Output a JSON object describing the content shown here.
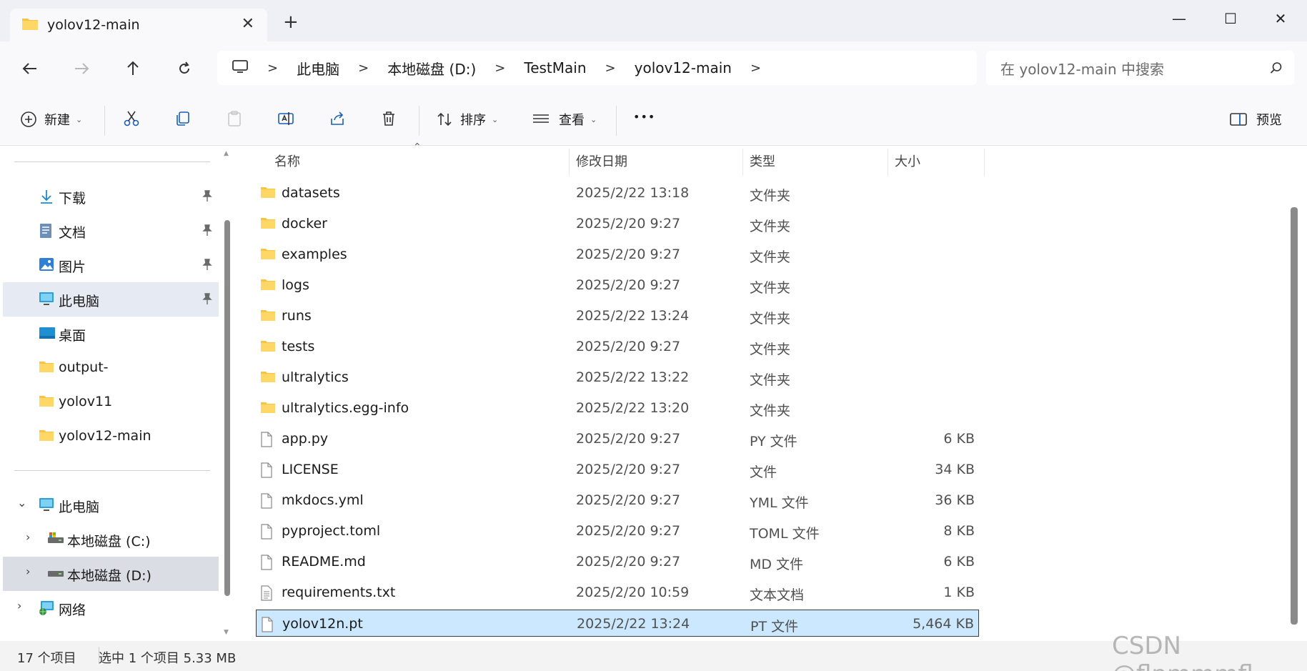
{
  "window": {
    "tab_title": "yolov12-main",
    "tab_close": "✕",
    "new_tab": "+",
    "minimize": "—",
    "maximize": "☐",
    "close": "✕"
  },
  "nav": {
    "breadcrumbs": [
      "此电脑",
      "本地磁盘 (D:)",
      "TestMain",
      "yolov12-main"
    ],
    "separator": ">",
    "search_placeholder": "在 yolov12-main 中搜索"
  },
  "toolbar": {
    "new_label": "新建",
    "sort_label": "排序",
    "view_label": "查看",
    "more_label": "•••",
    "preview_label": "预览"
  },
  "sidebar": {
    "quick_access": [
      {
        "label": "下载",
        "icon": "download-icon",
        "pinned": true
      },
      {
        "label": "文档",
        "icon": "document-icon",
        "pinned": true
      },
      {
        "label": "图片",
        "icon": "picture-icon",
        "pinned": true
      },
      {
        "label": "此电脑",
        "icon": "computer-icon",
        "pinned": true
      },
      {
        "label": "桌面",
        "icon": "desktop-icon",
        "pinned": false
      },
      {
        "label": "output-",
        "icon": "folder-icon",
        "pinned": false
      },
      {
        "label": "yolov11",
        "icon": "folder-icon",
        "pinned": false
      },
      {
        "label": "yolov12-main",
        "icon": "folder-icon",
        "pinned": false
      }
    ],
    "tree": [
      {
        "label": "此电脑",
        "icon": "computer-icon",
        "expander": "⌄"
      },
      {
        "label": "本地磁盘 (C:)",
        "icon": "drive-icon",
        "expander": "›"
      },
      {
        "label": "本地磁盘 (D:)",
        "icon": "drive-icon",
        "expander": "›"
      },
      {
        "label": "网络",
        "icon": "network-icon",
        "expander": "›"
      }
    ]
  },
  "columns": {
    "name": "名称",
    "date": "修改日期",
    "type": "类型",
    "size": "大小"
  },
  "files": [
    {
      "name": "datasets",
      "date": "2025/2/22 13:18",
      "type": "文件夹",
      "size": "",
      "kind": "folder"
    },
    {
      "name": "docker",
      "date": "2025/2/20 9:27",
      "type": "文件夹",
      "size": "",
      "kind": "folder"
    },
    {
      "name": "examples",
      "date": "2025/2/20 9:27",
      "type": "文件夹",
      "size": "",
      "kind": "folder"
    },
    {
      "name": "logs",
      "date": "2025/2/20 9:27",
      "type": "文件夹",
      "size": "",
      "kind": "folder"
    },
    {
      "name": "runs",
      "date": "2025/2/22 13:24",
      "type": "文件夹",
      "size": "",
      "kind": "folder"
    },
    {
      "name": "tests",
      "date": "2025/2/20 9:27",
      "type": "文件夹",
      "size": "",
      "kind": "folder"
    },
    {
      "name": "ultralytics",
      "date": "2025/2/22 13:22",
      "type": "文件夹",
      "size": "",
      "kind": "folder"
    },
    {
      "name": "ultralytics.egg-info",
      "date": "2025/2/22 13:20",
      "type": "文件夹",
      "size": "",
      "kind": "folder"
    },
    {
      "name": "app.py",
      "date": "2025/2/20 9:27",
      "type": "PY 文件",
      "size": "6 KB",
      "kind": "file"
    },
    {
      "name": "LICENSE",
      "date": "2025/2/20 9:27",
      "type": "文件",
      "size": "34 KB",
      "kind": "file"
    },
    {
      "name": "mkdocs.yml",
      "date": "2025/2/20 9:27",
      "type": "YML 文件",
      "size": "36 KB",
      "kind": "file"
    },
    {
      "name": "pyproject.toml",
      "date": "2025/2/20 9:27",
      "type": "TOML 文件",
      "size": "8 KB",
      "kind": "file"
    },
    {
      "name": "README.md",
      "date": "2025/2/20 9:27",
      "type": "MD 文件",
      "size": "6 KB",
      "kind": "file"
    },
    {
      "name": "requirements.txt",
      "date": "2025/2/20 10:59",
      "type": "文本文档",
      "size": "1 KB",
      "kind": "text"
    },
    {
      "name": "yolov12n.pt",
      "date": "2025/2/22 13:24",
      "type": "PT 文件",
      "size": "5,464 KB",
      "kind": "file",
      "selected": true
    }
  ],
  "status": {
    "item_count": "17 个项目",
    "selection": "选中 1 个项目  5.33 MB"
  },
  "watermark": "CSDN @flpmmmfl",
  "colors": {
    "accent": "#0067c0",
    "selection_bg": "#cce8ff",
    "folder": "#f8c43d"
  }
}
